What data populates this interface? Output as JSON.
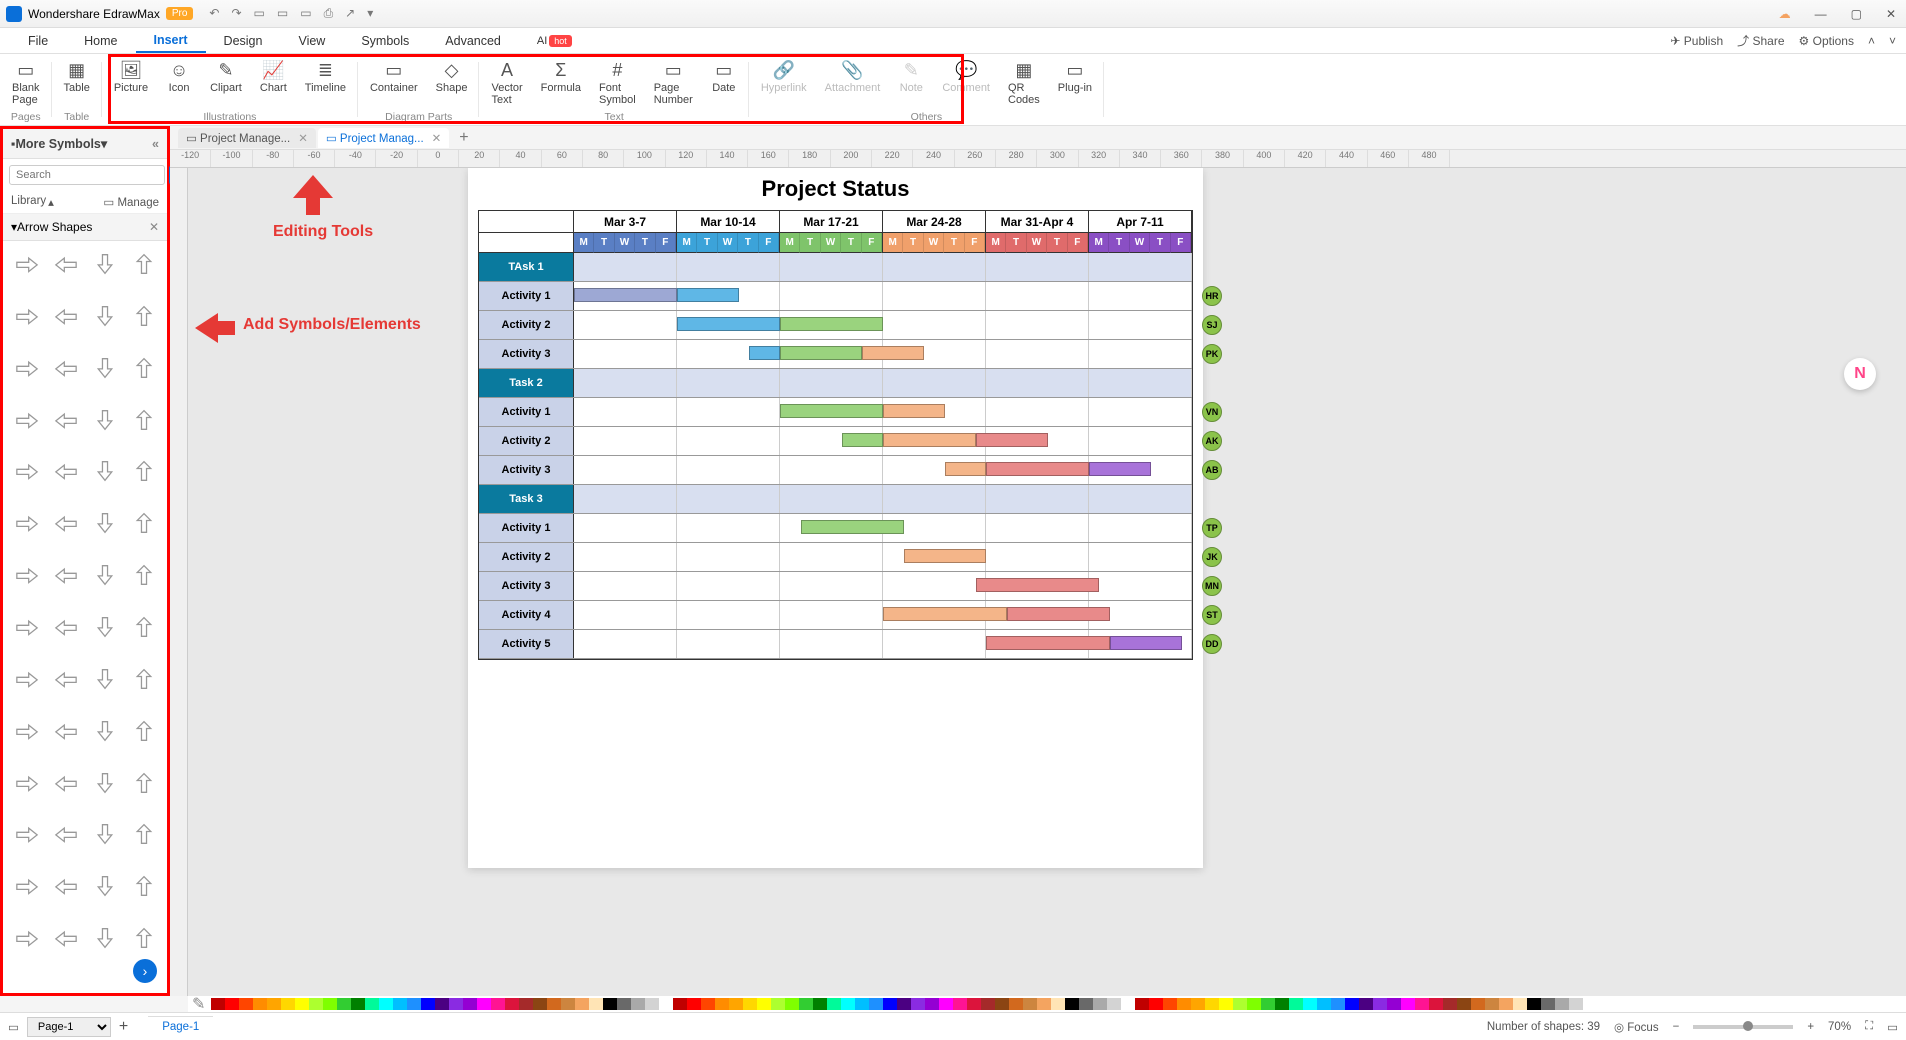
{
  "titlebar": {
    "app": "Wondershare EdrawMax",
    "badge": "Pro"
  },
  "menus": {
    "items": [
      "File",
      "Home",
      "Insert",
      "Design",
      "View",
      "Symbols",
      "Advanced"
    ],
    "active": "Insert",
    "ai": "AI",
    "hot": "hot",
    "right": {
      "publish": "Publish",
      "share": "Share",
      "options": "Options"
    }
  },
  "ribbon": {
    "groups": [
      {
        "label": "Pages",
        "tools": [
          {
            "name": "Blank Page",
            "icon": "▭"
          }
        ]
      },
      {
        "label": "Table",
        "tools": [
          {
            "name": "Table",
            "icon": "▦"
          }
        ]
      },
      {
        "label": "Illustrations",
        "tools": [
          {
            "name": "Picture",
            "icon": "🖼"
          },
          {
            "name": "Icon",
            "icon": "☺"
          },
          {
            "name": "Clipart",
            "icon": "✎"
          },
          {
            "name": "Chart",
            "icon": "📈"
          },
          {
            "name": "Timeline",
            "icon": "≣"
          }
        ]
      },
      {
        "label": "Diagram Parts",
        "tools": [
          {
            "name": "Container",
            "icon": "▭"
          },
          {
            "name": "Shape",
            "icon": "◇"
          }
        ]
      },
      {
        "label": "Text",
        "tools": [
          {
            "name": "Vector Text",
            "icon": "A"
          },
          {
            "name": "Formula",
            "icon": "Σ"
          },
          {
            "name": "Font Symbol",
            "icon": "#"
          },
          {
            "name": "Page Number",
            "icon": "▭"
          },
          {
            "name": "Date",
            "icon": "▭"
          }
        ]
      },
      {
        "label": "Others",
        "tools": [
          {
            "name": "Hyperlink",
            "icon": "🔗",
            "disabled": true
          },
          {
            "name": "Attachment",
            "icon": "📎",
            "disabled": true
          },
          {
            "name": "Note",
            "icon": "✎",
            "disabled": true
          },
          {
            "name": "Comment",
            "icon": "💬",
            "disabled": true
          },
          {
            "name": "QR Codes",
            "icon": "▦"
          },
          {
            "name": "Plug-in",
            "icon": "▭"
          }
        ]
      }
    ]
  },
  "left_panel": {
    "title": "More Symbols",
    "search_ph": "Search",
    "search_btn": "Search",
    "library": "Library",
    "manage": "Manage",
    "category": "Arrow Shapes"
  },
  "tabs": [
    {
      "label": "Project Manage...",
      "active": false
    },
    {
      "label": "Project Manag...",
      "active": true
    }
  ],
  "ruler_h": [
    -120,
    -100,
    -80,
    -60,
    -40,
    -20,
    0,
    20,
    40,
    60,
    80,
    100,
    120,
    140,
    160,
    180,
    200,
    220,
    240,
    260,
    280,
    300,
    320,
    340,
    360,
    380,
    400,
    420,
    440,
    460,
    480
  ],
  "annotations": {
    "top": "Editing Tools",
    "left": "Add Symbols/Elements"
  },
  "chart_data": {
    "type": "gantt",
    "title": "Project Status",
    "weeks": [
      {
        "label": "Mar 3-7",
        "color": "#5a7fc4"
      },
      {
        "label": "Mar 10-14",
        "color": "#3ca3d9"
      },
      {
        "label": "Mar 17-21",
        "color": "#7fc46b"
      },
      {
        "label": "Mar 24-28",
        "color": "#f0a06b"
      },
      {
        "label": "Mar 31-Apr 4",
        "color": "#e06b6b"
      },
      {
        "label": "Apr 7-11",
        "color": "#8a4fc4"
      }
    ],
    "days": [
      "M",
      "T",
      "W",
      "T",
      "F"
    ],
    "rows": [
      {
        "type": "task",
        "label": "TAsk 1"
      },
      {
        "type": "act",
        "label": "Activity 1",
        "avatar": "HR",
        "bars": [
          {
            "start": 0,
            "len": 5,
            "color": "#9da8d4"
          },
          {
            "start": 5,
            "len": 3,
            "color": "#5fb7e6"
          }
        ]
      },
      {
        "type": "act",
        "label": "Activity 2",
        "avatar": "SJ",
        "bars": [
          {
            "start": 5,
            "len": 5,
            "color": "#5fb7e6"
          },
          {
            "start": 10,
            "len": 5,
            "color": "#9ad37e"
          }
        ]
      },
      {
        "type": "act",
        "label": "Activity 3",
        "avatar": "PK",
        "bars": [
          {
            "start": 8.5,
            "len": 1.5,
            "color": "#5fb7e6"
          },
          {
            "start": 10,
            "len": 4,
            "color": "#9ad37e"
          },
          {
            "start": 14,
            "len": 3,
            "color": "#f4b589"
          }
        ]
      },
      {
        "type": "task",
        "label": "Task 2"
      },
      {
        "type": "act",
        "label": "Activity 1",
        "avatar": "VN",
        "bars": [
          {
            "start": 10,
            "len": 5,
            "color": "#9ad37e"
          },
          {
            "start": 15,
            "len": 3,
            "color": "#f4b589"
          }
        ]
      },
      {
        "type": "act",
        "label": "Activity 2",
        "avatar": "AK",
        "bars": [
          {
            "start": 13,
            "len": 2,
            "color": "#9ad37e"
          },
          {
            "start": 15,
            "len": 4.5,
            "color": "#f4b589"
          },
          {
            "start": 19.5,
            "len": 3.5,
            "color": "#e88a8a"
          }
        ]
      },
      {
        "type": "act",
        "label": "Activity 3",
        "avatar": "AB",
        "bars": [
          {
            "start": 18,
            "len": 2,
            "color": "#f4b589"
          },
          {
            "start": 20,
            "len": 5,
            "color": "#e88a8a"
          },
          {
            "start": 25,
            "len": 3,
            "color": "#a873d9"
          }
        ]
      },
      {
        "type": "task",
        "label": "Task 3"
      },
      {
        "type": "act",
        "label": "Activity 1",
        "avatar": "TP",
        "bars": [
          {
            "start": 11,
            "len": 5,
            "color": "#9ad37e"
          }
        ]
      },
      {
        "type": "act",
        "label": "Activity 2",
        "avatar": "JK",
        "bars": [
          {
            "start": 16,
            "len": 4,
            "color": "#f4b589"
          }
        ]
      },
      {
        "type": "act",
        "label": "Activity 3",
        "avatar": "MN",
        "bars": [
          {
            "start": 19.5,
            "len": 6,
            "color": "#e88a8a"
          }
        ]
      },
      {
        "type": "act",
        "label": "Activity 4",
        "avatar": "ST",
        "bars": [
          {
            "start": 15,
            "len": 6,
            "color": "#f4b589"
          },
          {
            "start": 21,
            "len": 5,
            "color": "#e88a8a"
          }
        ]
      },
      {
        "type": "act",
        "label": "Activity 5",
        "avatar": "DD",
        "bars": [
          {
            "start": 20,
            "len": 6,
            "color": "#e88a8a"
          },
          {
            "start": 26,
            "len": 3.5,
            "color": "#a873d9"
          }
        ]
      }
    ]
  },
  "palette": [
    "#c00000",
    "#ff0000",
    "#ff4500",
    "#ff8c00",
    "#ffa500",
    "#ffd700",
    "#ffff00",
    "#adff2f",
    "#7fff00",
    "#32cd32",
    "#008000",
    "#00fa9a",
    "#00ffff",
    "#00bfff",
    "#1e90ff",
    "#0000ff",
    "#4b0082",
    "#8a2be2",
    "#9400d3",
    "#ff00ff",
    "#ff1493",
    "#dc143c",
    "#a52a2a",
    "#8b4513",
    "#d2691e",
    "#cd853f",
    "#f4a460",
    "#ffe4b5",
    "#000000",
    "#696969",
    "#a9a9a9",
    "#d3d3d3",
    "#ffffff"
  ],
  "status": {
    "page_sel": "Page-1",
    "page_tab": "Page-1",
    "shapes": "Number of shapes: 39",
    "focus": "Focus",
    "zoom": "70%"
  }
}
